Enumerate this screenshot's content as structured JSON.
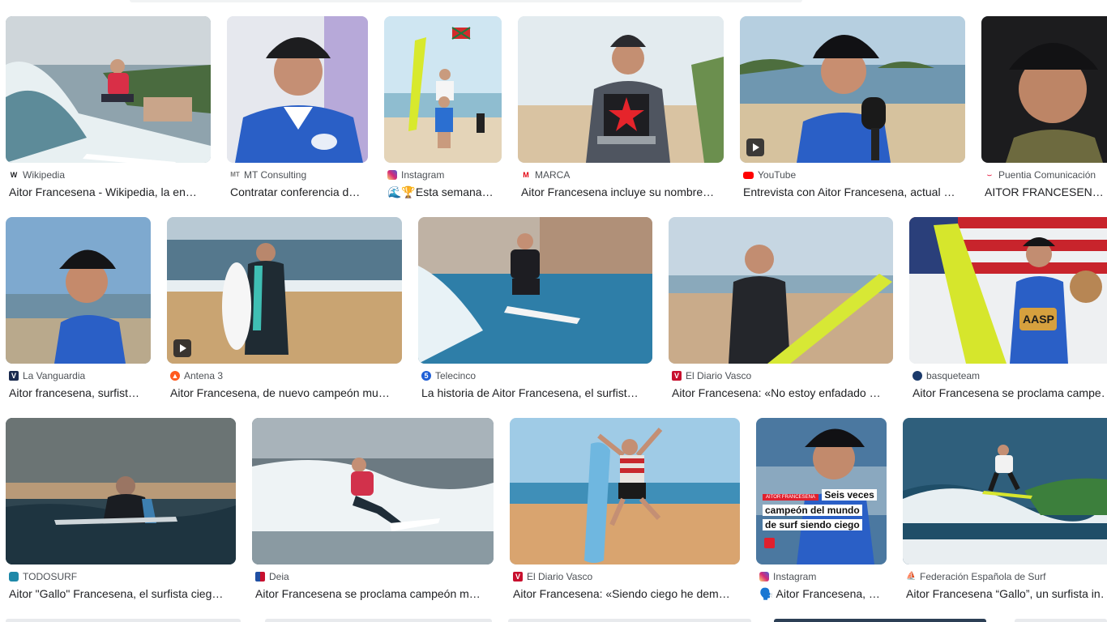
{
  "results": [
    [
      {
        "source": "Wikipedia",
        "title": "Aitor Francesena - Wikipedia, la en…",
        "favicon": "w-icon",
        "fav_color": "#ffffff",
        "video": false
      },
      {
        "source": "MT Consulting",
        "title": "Contratar conferencia d…",
        "favicon": "mt-icon",
        "fav_color": "#ffffff",
        "video": false
      },
      {
        "source": "Instagram",
        "title": "🌊🏆Esta semana…",
        "favicon": "instagram-icon",
        "fav_color": "#d62976",
        "video": false
      },
      {
        "source": "MARCA",
        "title": "Aitor Francesena incluye su nombre…",
        "favicon": "marca-icon",
        "fav_color": "#e30613",
        "video": false
      },
      {
        "source": "YouTube",
        "title": "Entrevista con Aitor Francesena, actual …",
        "favicon": "youtube-icon",
        "fav_color": "#ff0000",
        "video": true
      },
      {
        "source": "Puentia Comunicación",
        "title": "AITOR FRANCESENA …",
        "favicon": "puentia-icon",
        "fav_color": "#e4002b",
        "video": false
      }
    ],
    [
      {
        "source": "La Vanguardia",
        "title": "Aitor francesena, surfist…",
        "favicon": "lavanguardia-icon",
        "fav_color": "#1a2a4f",
        "video": false
      },
      {
        "source": "Antena 3",
        "title": "Aitor Francesena, de nuevo campeón mu…",
        "favicon": "antena3-icon",
        "fav_color": "#ff5a1f",
        "video": true
      },
      {
        "source": "Telecinco",
        "title": "La historia de Aitor Francesena, el surfist…",
        "favicon": "telecinco-icon",
        "fav_color": "#1f5fd6",
        "video": false
      },
      {
        "source": "El Diario Vasco",
        "title": "Aitor Francesena: «No estoy enfadado …",
        "favicon": "diariovasco-icon",
        "fav_color": "#c8102e",
        "video": false
      },
      {
        "source": "basqueteam",
        "title": "Aitor Francesena se proclama campe…",
        "favicon": "basqueteam-icon",
        "fav_color": "#1b3a6b",
        "video": false
      }
    ],
    [
      {
        "source": "TODOSURF",
        "title": "Aitor \"Gallo\" Francesena, el surfista cieg…",
        "favicon": "todosurf-icon",
        "fav_color": "#1e88a8",
        "video": false
      },
      {
        "source": "Deia",
        "title": "Aitor Francesena se proclama campeón m…",
        "favicon": "deia-icon",
        "fav_color": "#c8102e",
        "video": false
      },
      {
        "source": "El Diario Vasco",
        "title": "Aitor Francesena: «Siendo ciego he dem…",
        "favicon": "diariovasco-icon",
        "fav_color": "#c8102e",
        "video": false
      },
      {
        "source": "Instagram",
        "title": "🗣️ Aitor Francesena, …",
        "favicon": "instagram-icon",
        "fav_color": "#d62976",
        "video": false
      },
      {
        "source": "Federación Española de Surf",
        "title": "Aitor Francesena “Gallo”, un surfista in…",
        "favicon": "fesurf-icon",
        "fav_color": "#ffffff",
        "video": false
      }
    ]
  ],
  "overlay": {
    "tag": "AITOR FRANCESENA",
    "line1": "Seis veces",
    "line2": "campeón del mundo",
    "line3": "de surf siendo ciego"
  },
  "sign": {
    "text": "AASP"
  }
}
